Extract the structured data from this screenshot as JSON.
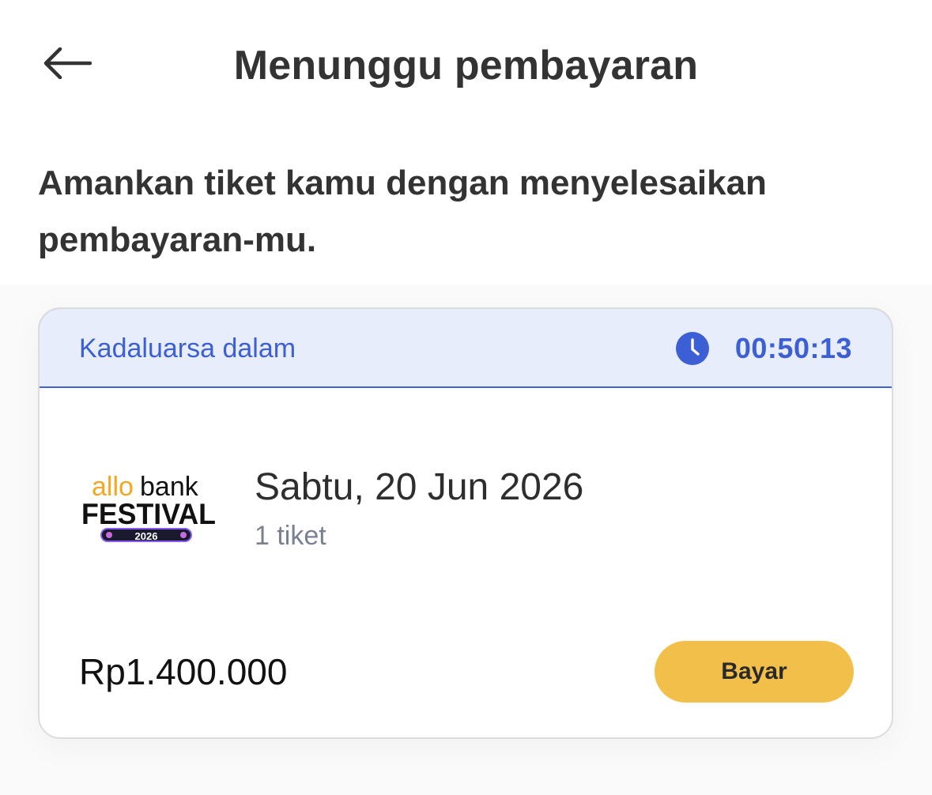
{
  "header": {
    "title": "Menunggu pembayaran",
    "back_icon": "arrow-left-icon"
  },
  "intro": {
    "text": "Amankan tiket kamu dengan menyelesaikan pembayaran-mu."
  },
  "order_card": {
    "expiry": {
      "label": "Kadaluarsa dalam",
      "icon": "clock-icon",
      "countdown": "00:50:13"
    },
    "event": {
      "logo": {
        "line1_a": "allo",
        "line1_b": "bank",
        "line2": "FESTIVAL",
        "line3": "2026"
      },
      "date": "Sabtu, 20 Jun 2026",
      "ticket_count": "1 tiket"
    },
    "price": "Rp1.400.000",
    "pay_label": "Bayar"
  },
  "colors": {
    "accent_blue": "#3d5fd5",
    "expiry_bg": "#e8edfb",
    "pay_button": "#f2c04a",
    "logo_orange": "#f5a623"
  }
}
